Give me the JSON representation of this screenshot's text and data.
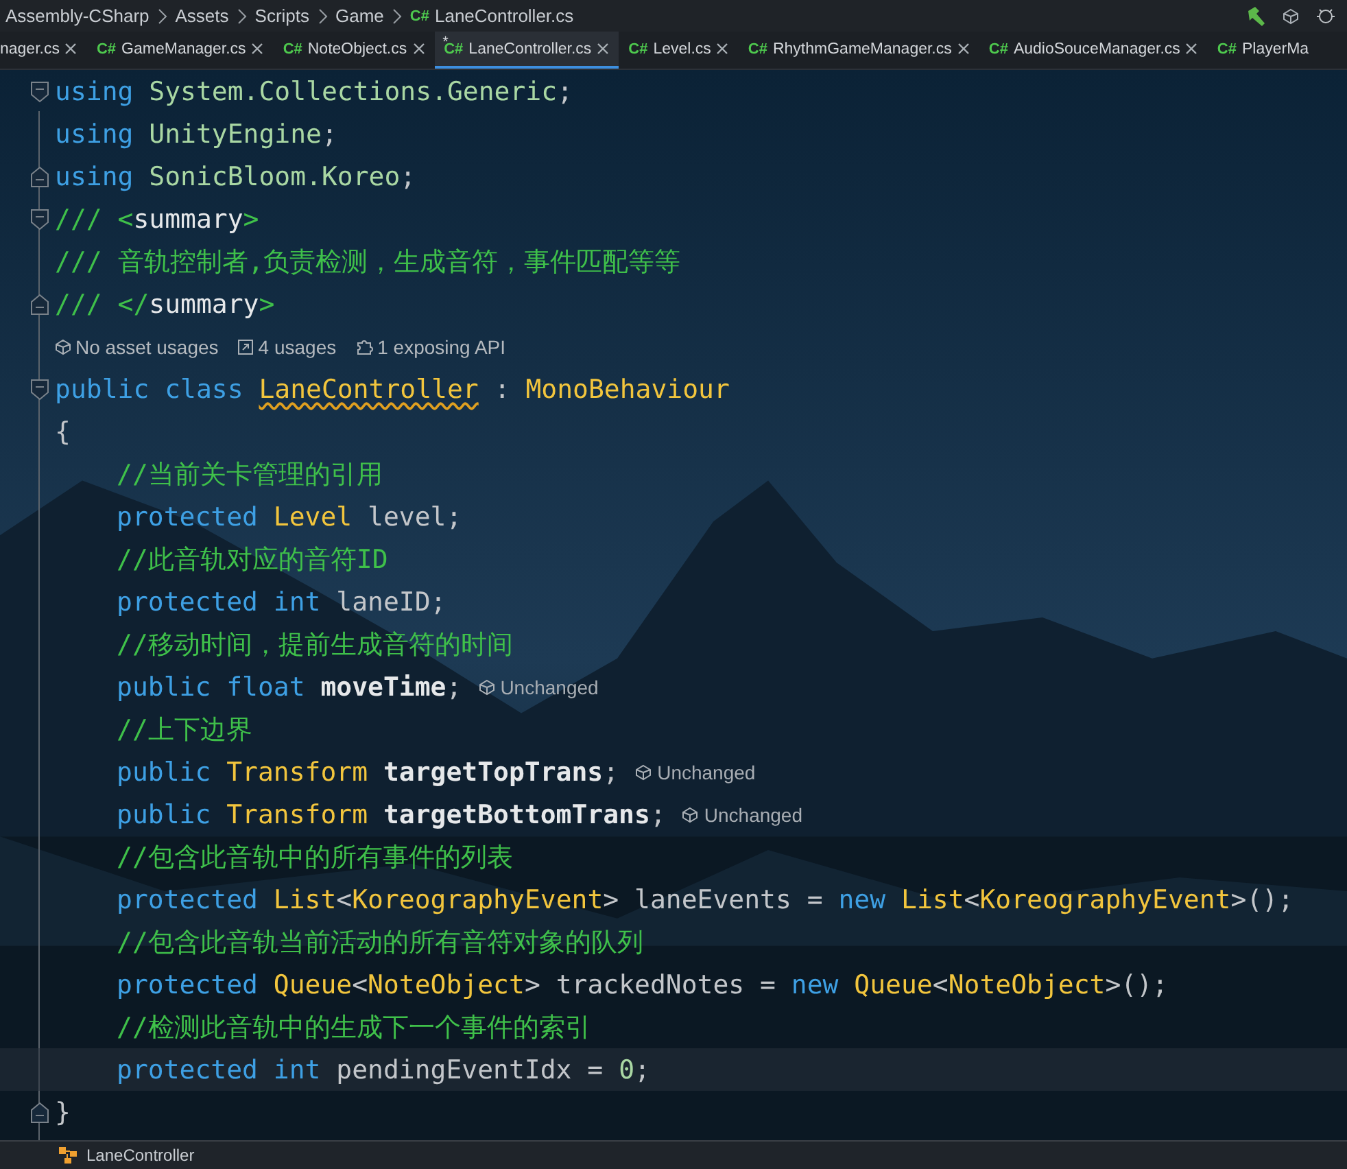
{
  "breadcrumb": [
    {
      "label": "Assembly-CSharp"
    },
    {
      "label": "Assets"
    },
    {
      "label": "Scripts"
    },
    {
      "label": "Game"
    },
    {
      "label": "LaneController.cs",
      "lang": "C#"
    }
  ],
  "tabs": [
    {
      "label": "nager.cs",
      "selected": false,
      "close": true
    },
    {
      "label": "GameManager.cs",
      "lang": "C#",
      "selected": false,
      "close": true
    },
    {
      "label": "NoteObject.cs",
      "lang": "C#",
      "selected": false,
      "close": true
    },
    {
      "label": "LaneController.cs",
      "lang": "C#",
      "marker": "*",
      "selected": true,
      "close": true
    },
    {
      "label": "Level.cs",
      "lang": "C#",
      "selected": false,
      "close": true
    },
    {
      "label": "RhythmGameManager.cs",
      "lang": "C#",
      "selected": false,
      "close": true
    },
    {
      "label": "AudioSouceManager.cs",
      "lang": "C#",
      "selected": false,
      "close": true
    },
    {
      "label": "PlayerMa",
      "lang": "C#",
      "selected": false,
      "close": false
    }
  ],
  "code": [
    {
      "kind": "code",
      "fold_start": true,
      "fold_end": false,
      "current": false,
      "tokens": [
        {
          "kind": "kw",
          "s": "using"
        },
        {
          "kind": "ns",
          "s": " System.Collections.Generic"
        },
        {
          "kind": "plain",
          "s": ";"
        }
      ]
    },
    {
      "kind": "code",
      "fold_start": false,
      "fold_end": false,
      "current": false,
      "tokens": [
        {
          "kind": "kw",
          "s": "using"
        },
        {
          "kind": "ns",
          "s": " UnityEngine"
        },
        {
          "kind": "plain",
          "s": ";"
        }
      ]
    },
    {
      "kind": "code",
      "fold_start": false,
      "fold_end": true,
      "current": false,
      "tokens": [
        {
          "kind": "kw",
          "s": "using"
        },
        {
          "kind": "ns",
          "s": " SonicBloom.Koreo"
        },
        {
          "kind": "plain",
          "s": ";"
        }
      ]
    },
    {
      "kind": "code",
      "fold_start": true,
      "fold_end": false,
      "current": false,
      "tokens": [
        {
          "kind": "comment",
          "s": "/// <"
        },
        {
          "kind": "tag",
          "s": "summary"
        },
        {
          "kind": "comment",
          "s": ">"
        }
      ]
    },
    {
      "kind": "code",
      "fold_start": false,
      "fold_end": false,
      "current": false,
      "tokens": [
        {
          "kind": "comment",
          "s": "/// 音轨控制者,负责检测，生成音符，事件匹配等等"
        }
      ]
    },
    {
      "kind": "code",
      "fold_start": false,
      "fold_end": true,
      "current": false,
      "tokens": [
        {
          "kind": "comment",
          "s": "/// </"
        },
        {
          "kind": "tag",
          "s": "summary"
        },
        {
          "kind": "comment",
          "s": ">"
        }
      ]
    },
    {
      "kind": "usages",
      "fold_start": false,
      "fold_end": false,
      "current": false,
      "items": [
        "No asset usages",
        "4 usages",
        "1 exposing API"
      ]
    },
    {
      "kind": "code",
      "fold_start": true,
      "fold_end": false,
      "current": false,
      "tokens": [
        {
          "kind": "kw",
          "s": "public class "
        },
        {
          "kind": "squiggle",
          "s": "LaneController"
        },
        {
          "kind": "plain",
          "s": " : "
        },
        {
          "kind": "type",
          "s": "MonoBehaviour"
        }
      ]
    },
    {
      "kind": "code",
      "fold_start": false,
      "fold_end": false,
      "current": false,
      "tokens": [
        {
          "kind": "plain",
          "s": "{"
        }
      ],
      "children": [
        {
          "kind": "code",
          "fold_start": false,
          "fold_end": false,
          "current": false,
          "tokens": [
            {
              "kind": "comment",
              "s": "//当前关卡管理的引用"
            }
          ]
        },
        {
          "kind": "code",
          "fold_start": false,
          "fold_end": false,
          "current": false,
          "tokens": [
            {
              "kind": "kw",
              "s": "protected "
            },
            {
              "kind": "type",
              "s": "Level"
            },
            {
              "kind": "plain",
              "s": " level;"
            }
          ]
        },
        {
          "kind": "code",
          "fold_start": false,
          "fold_end": false,
          "current": false,
          "tokens": [
            {
              "kind": "comment",
              "s": "//此音轨对应的音符ID"
            }
          ]
        },
        {
          "kind": "code",
          "fold_start": false,
          "fold_end": false,
          "current": false,
          "tokens": [
            {
              "kind": "kw",
              "s": "protected int"
            },
            {
              "kind": "plain",
              "s": " laneID;"
            }
          ]
        },
        {
          "kind": "code",
          "fold_start": false,
          "fold_end": false,
          "current": false,
          "tokens": [
            {
              "kind": "comment",
              "s": "//移动时间，提前生成音符的时间"
            }
          ]
        },
        {
          "kind": "code",
          "fold_start": false,
          "fold_end": false,
          "current": false,
          "hint": "Unchanged",
          "tokens": [
            {
              "kind": "kw",
              "s": "public float "
            },
            {
              "kind": "member",
              "s": "moveTime"
            },
            {
              "kind": "plain",
              "s": ";"
            }
          ]
        },
        {
          "kind": "code",
          "fold_start": false,
          "fold_end": false,
          "current": false,
          "tokens": [
            {
              "kind": "comment",
              "s": "//上下边界"
            }
          ]
        },
        {
          "kind": "code",
          "fold_start": false,
          "fold_end": false,
          "current": false,
          "hint": "Unchanged",
          "tokens": [
            {
              "kind": "kw",
              "s": "public "
            },
            {
              "kind": "type",
              "s": "Transform "
            },
            {
              "kind": "member",
              "s": "targetTopTrans"
            },
            {
              "kind": "plain",
              "s": ";"
            }
          ]
        },
        {
          "kind": "code",
          "fold_start": false,
          "fold_end": false,
          "current": false,
          "hint": "Unchanged",
          "tokens": [
            {
              "kind": "kw",
              "s": "public "
            },
            {
              "kind": "type",
              "s": "Transform "
            },
            {
              "kind": "member",
              "s": "targetBottomTrans"
            },
            {
              "kind": "plain",
              "s": ";"
            }
          ]
        },
        {
          "kind": "code",
          "fold_start": false,
          "fold_end": false,
          "current": false,
          "tokens": [
            {
              "kind": "comment",
              "s": "//包含此音轨中的所有事件的列表"
            }
          ]
        },
        {
          "kind": "code",
          "fold_start": false,
          "fold_end": false,
          "current": false,
          "tokens": [
            {
              "kind": "kw",
              "s": "protected "
            },
            {
              "kind": "type",
              "s": "List"
            },
            {
              "kind": "plain",
              "s": "<"
            },
            {
              "kind": "type",
              "s": "KoreographyEvent"
            },
            {
              "kind": "plain",
              "s": "> laneEvents = "
            },
            {
              "kind": "kw",
              "s": "new "
            },
            {
              "kind": "type",
              "s": "List"
            },
            {
              "kind": "plain",
              "s": "<"
            },
            {
              "kind": "type",
              "s": "KoreographyEvent"
            },
            {
              "kind": "plain",
              "s": ">();"
            }
          ]
        },
        {
          "kind": "code",
          "fold_start": false,
          "fold_end": false,
          "current": false,
          "tokens": [
            {
              "kind": "comment",
              "s": "//包含此音轨当前活动的所有音符对象的队列"
            }
          ]
        },
        {
          "kind": "code",
          "fold_start": false,
          "fold_end": false,
          "current": false,
          "tokens": [
            {
              "kind": "kw",
              "s": "protected "
            },
            {
              "kind": "type",
              "s": "Queue"
            },
            {
              "kind": "plain",
              "s": "<"
            },
            {
              "kind": "type",
              "s": "NoteObject"
            },
            {
              "kind": "plain",
              "s": "> trackedNotes = "
            },
            {
              "kind": "kw",
              "s": "new "
            },
            {
              "kind": "type",
              "s": "Queue"
            },
            {
              "kind": "plain",
              "s": "<"
            },
            {
              "kind": "type",
              "s": "NoteObject"
            },
            {
              "kind": "plain",
              "s": ">();"
            }
          ]
        },
        {
          "kind": "code",
          "fold_start": false,
          "fold_end": false,
          "current": false,
          "tokens": [
            {
              "kind": "comment",
              "s": "//检测此音轨中的生成下一个事件的索引"
            }
          ]
        },
        {
          "kind": "code",
          "fold_start": false,
          "fold_end": false,
          "current": true,
          "tokens": [
            {
              "kind": "kw",
              "s": "protected int"
            },
            {
              "kind": "plain",
              "s": " pendingEventIdx = "
            },
            {
              "kind": "num",
              "s": "0"
            },
            {
              "kind": "plain",
              "s": ";"
            }
          ]
        }
      ]
    },
    {
      "kind": "code",
      "fold_start": false,
      "fold_end": true,
      "current": false,
      "tokens": [
        {
          "kind": "plain",
          "s": "}"
        }
      ]
    }
  ],
  "status_bar": {
    "label": "LaneController"
  }
}
